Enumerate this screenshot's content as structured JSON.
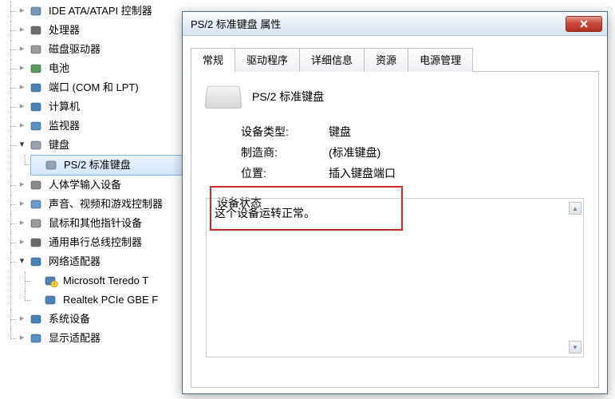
{
  "tree": {
    "items": [
      {
        "label": "IDE ATA/ATAPI 控制器",
        "icon": "chip",
        "exp": "closed"
      },
      {
        "label": "处理器",
        "icon": "cpu",
        "exp": "closed"
      },
      {
        "label": "磁盘驱动器",
        "icon": "disk",
        "exp": "closed"
      },
      {
        "label": "电池",
        "icon": "battery",
        "exp": "closed"
      },
      {
        "label": "端口 (COM 和 LPT)",
        "icon": "port",
        "exp": "closed"
      },
      {
        "label": "计算机",
        "icon": "computer",
        "exp": "closed"
      },
      {
        "label": "监视器",
        "icon": "monitor",
        "exp": "closed"
      },
      {
        "label": "键盘",
        "icon": "keyboard",
        "exp": "open",
        "children": [
          {
            "label": "PS/2 标准键盘",
            "icon": "keyboard",
            "exp": "none",
            "selected": true
          }
        ]
      },
      {
        "label": "人体学输入设备",
        "icon": "hid",
        "exp": "closed"
      },
      {
        "label": "声音、视频和游戏控制器",
        "icon": "sound",
        "exp": "closed"
      },
      {
        "label": "鼠标和其他指针设备",
        "icon": "mouse",
        "exp": "closed"
      },
      {
        "label": "通用串行总线控制器",
        "icon": "usb",
        "exp": "closed"
      },
      {
        "label": "网络适配器",
        "icon": "net",
        "exp": "open",
        "children": [
          {
            "label": "Microsoft Teredo T",
            "icon": "neterr",
            "exp": "none"
          },
          {
            "label": "Realtek PCIe GBE F",
            "icon": "net",
            "exp": "none"
          }
        ]
      },
      {
        "label": "系统设备",
        "icon": "system",
        "exp": "closed"
      },
      {
        "label": "显示适配器",
        "icon": "display",
        "exp": "closed"
      }
    ]
  },
  "dialog": {
    "title": "PS/2 标准键盘 属性",
    "tabs": [
      "常规",
      "驱动程序",
      "详细信息",
      "资源",
      "电源管理"
    ],
    "active_tab": 0,
    "device_name": "PS/2 标准键盘",
    "rows": [
      {
        "k": "设备类型:",
        "v": "键盘"
      },
      {
        "k": "制造商:",
        "v": "(标准键盘)"
      },
      {
        "k": "位置:",
        "v": "插入键盘端口"
      }
    ],
    "status_label": "设备状态",
    "status_text": "这个设备运转正常。"
  }
}
